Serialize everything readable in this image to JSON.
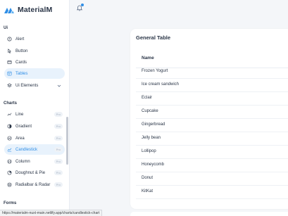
{
  "brand": {
    "name": "MaterialM"
  },
  "sidebar": {
    "sections": [
      {
        "heading": "Ui"
      },
      {
        "heading": "Charts"
      },
      {
        "heading": "Forms"
      }
    ],
    "items": [
      {
        "label": "Alert"
      },
      {
        "label": "Button"
      },
      {
        "label": "Cards"
      },
      {
        "label": "Tables"
      },
      {
        "label": "Ui Elements"
      },
      {
        "label": "Line",
        "badge": "Pro"
      },
      {
        "label": "Gradient",
        "badge": "Pro"
      },
      {
        "label": "Area",
        "badge": "Pro"
      },
      {
        "label": "Candlestick",
        "badge": "Pro"
      },
      {
        "label": "Column",
        "badge": "Pro"
      },
      {
        "label": "Doughnut & Pie",
        "badge": "Pro"
      },
      {
        "label": "Radialbar & Radar",
        "badge": "Pro"
      }
    ]
  },
  "card": {
    "title": "General Table",
    "column_header": "Name",
    "rows": [
      "Frozen Yogurt",
      "Ice cream sandwich",
      "Eclair",
      "Cupcake",
      "Gingerbread",
      "Jelly bean",
      "Lollipop",
      "Honeycomb",
      "Donut",
      "KitKat"
    ]
  },
  "status_bar": {
    "url": "https://materialm-nuxt-main.netlify.app/charts/candlestick-chart"
  },
  "colors": {
    "accent": "#2f8ee6",
    "active_bg": "#e8f2fc",
    "text": "#2a3547",
    "page_bg": "#f4f6f9"
  }
}
